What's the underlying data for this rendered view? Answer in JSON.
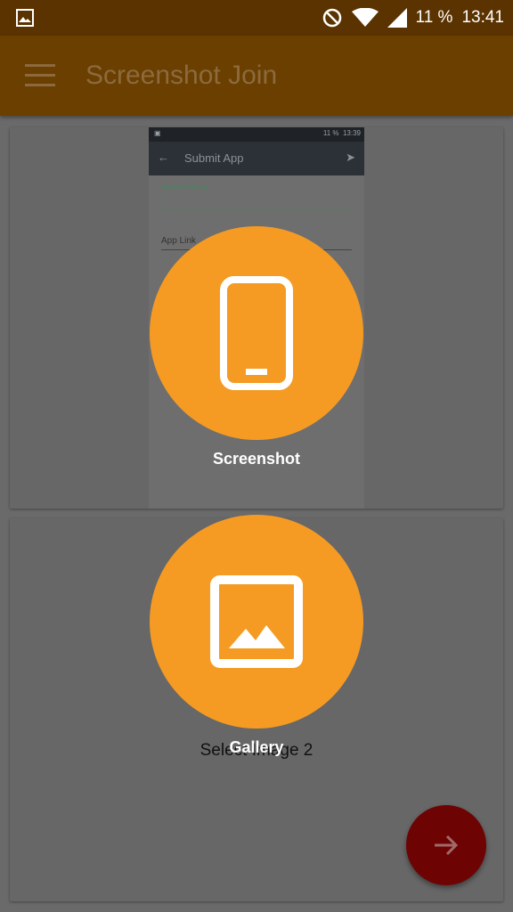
{
  "status_bar": {
    "battery": "11 %",
    "time": "13:41"
  },
  "app_bar": {
    "title": "Screenshot Join"
  },
  "preview": {
    "status_battery": "11 %",
    "status_time": "13:39",
    "toolbar_title": "Submit App",
    "field1_label": "Name of the App",
    "field2_label": "App Link"
  },
  "actions": {
    "screenshot_label": "Screenshot",
    "gallery_label": "Gallery"
  },
  "card2": {
    "select_text": "Select Image 2"
  },
  "colors": {
    "accent": "#f59b24",
    "appbar": "#6b3f00",
    "fab": "#6e0303"
  }
}
